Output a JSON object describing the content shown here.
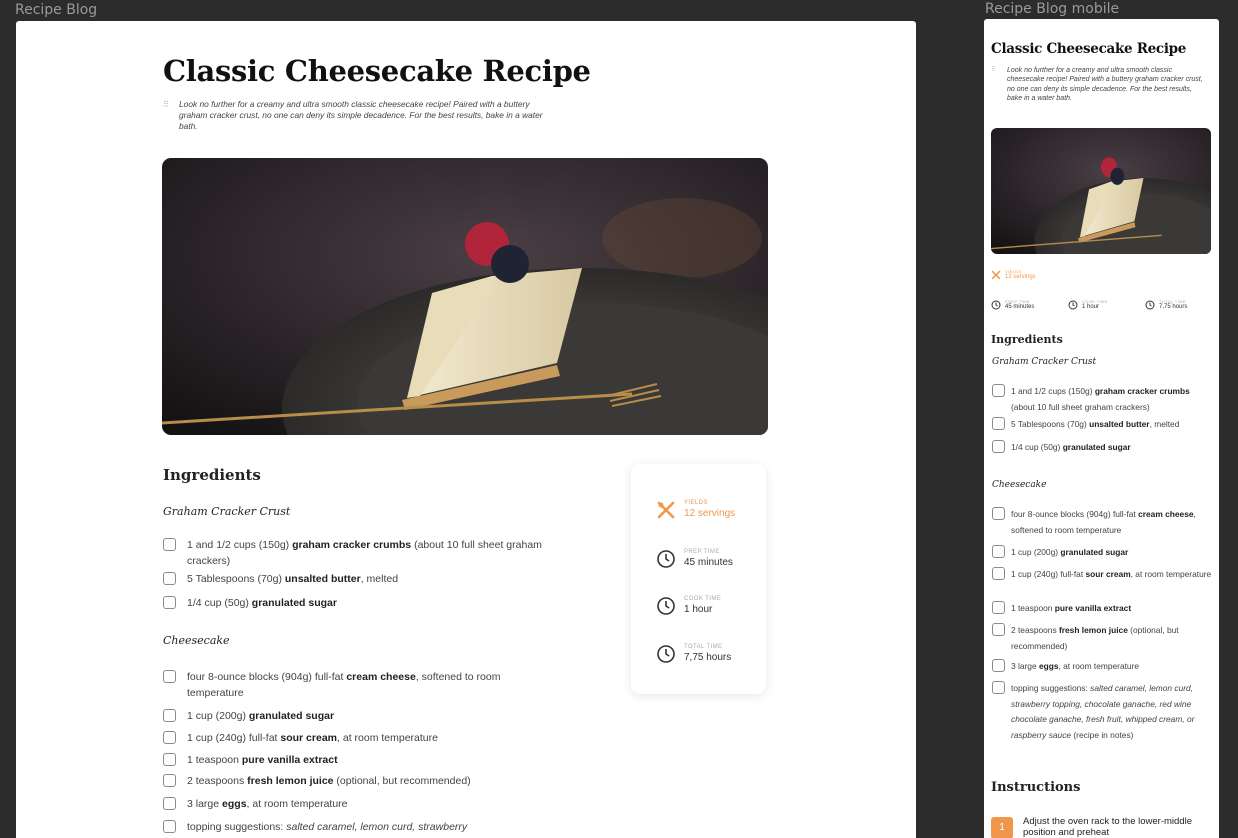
{
  "frames": {
    "desktop_label": "Recipe Blog",
    "mobile_label": "Recipe Blog mobile"
  },
  "recipe": {
    "title": "Classic Cheesecake Recipe",
    "intro": "Look no further for a creamy and ultra smooth classic cheesecake recipe! Paired with a buttery graham cracker crust, no one can deny its simple decadence. For the best results, bake in a water bath.",
    "intro_mobile": "Look no further for a creamy and ultra smooth classic cheesecake recipe! Paired with a buttery graham cracker crust, no one can deny its simple decadence. For the best results, bake in a water bath.",
    "image_icon": "cheesecake-photo",
    "ingredients_heading": "Ingredients",
    "crust_heading": "Graham Cracker Crust",
    "cheesecake_heading": "Cheesecake",
    "crust_items": [
      {
        "pre": "1 and 1/2 cups (150g) ",
        "bold": "graham cracker crumbs",
        "post": " (about 10 full sheet graham crackers)"
      },
      {
        "pre": "5 Tablespoons (70g) ",
        "bold": "unsalted butter",
        "post": ", melted"
      },
      {
        "pre": "1/4 cup (50g) ",
        "bold": "granulated sugar",
        "post": ""
      }
    ],
    "cheesecake_items": [
      {
        "pre": "four 8-ounce blocks (904g) full-fat ",
        "bold": "cream cheese",
        "post": ", softened to room temperature"
      },
      {
        "pre": "1 cup (200g) ",
        "bold": "granulated sugar",
        "post": ""
      },
      {
        "pre": "1 cup (240g) full-fat ",
        "bold": "sour cream",
        "post": ", at room temperature"
      },
      {
        "pre": "1 teaspoon ",
        "bold": "pure vanilla extract",
        "post": ""
      },
      {
        "pre": "2 teaspoons ",
        "bold": "fresh lemon juice",
        "post": " (optional, but recommended)"
      },
      {
        "pre": "3 large ",
        "bold": "eggs",
        "post": ", at room temperature"
      },
      {
        "pre": "topping suggestions: ",
        "italic": "salted caramel, lemon curd, strawberry topping, chocolate ganache, red wine chocolate ganache, fresh fruit, whipped cream, or raspberry sauce",
        "post": " (recipe in notes)"
      }
    ],
    "topping_desktop_italic": "salted caramel, lemon curd, strawberry",
    "info": {
      "yields_label": "YIELDS",
      "yields_value": "12 servings",
      "prep_label": "PREP TIME",
      "prep_value": "45 minutes",
      "cook_label": "COOK TIME",
      "cook_value": "1 hour",
      "total_label": "TOTAL TIME",
      "total_value": "7,75 hours"
    },
    "instructions_heading": "Instructions",
    "steps": [
      {
        "num": "1",
        "text": "Adjust the oven rack to the lower-middle position and preheat"
      }
    ]
  },
  "icons": [
    "utensils-icon",
    "clock-icon",
    "drag-handle-icon"
  ],
  "colors": {
    "accent": "#f0964a",
    "background": "#2c2c2c",
    "canvas": "#ffffff"
  }
}
